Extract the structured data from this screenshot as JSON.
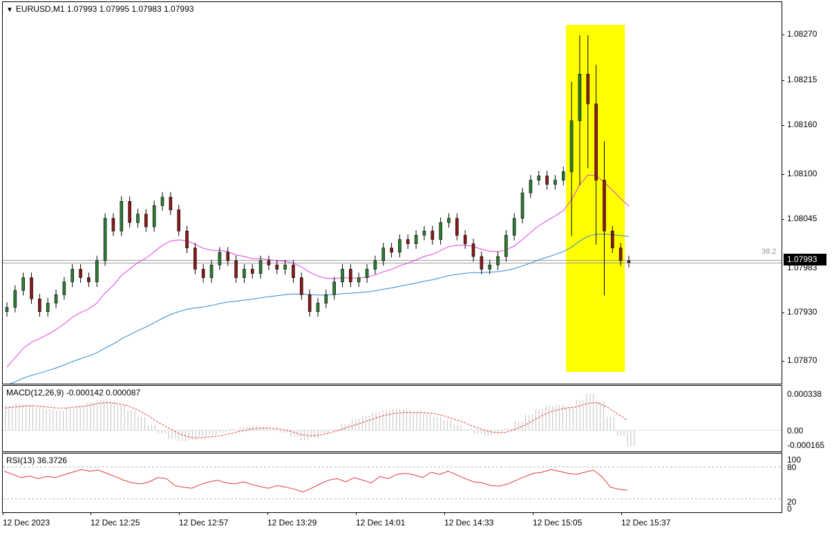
{
  "symbol_header": "EURUSD,M1  1.07993 1.07995 1.07983 1.07993",
  "current_price": "1.07993",
  "fibo_label": "38.2",
  "price_axis": [
    "1.08270",
    "1.08215",
    "1.08160",
    "1.08100",
    "1.08045",
    "1.07983",
    "1.07930",
    "1.07870"
  ],
  "macd_header": "MACD(12,26,9) -0.000142 0.000087",
  "macd_axis": [
    "0.000338",
    "0.00",
    "-0.000165"
  ],
  "rsi_header": "RSI(13) 36.3726",
  "rsi_axis": [
    "100",
    "80",
    "20",
    "0"
  ],
  "time_axis": [
    "12 Dec 2023",
    "12 Dec 12:25",
    "12 Dec 12:57",
    "12 Dec 13:29",
    "12 Dec 14:01",
    "12 Dec 14:33",
    "12 Dec 15:05",
    "12 Dec 15:37"
  ],
  "colors": {
    "bull": "#2e7d32",
    "bear": "#8b1a1a",
    "ma_fast": "#e040e0",
    "ma_slow": "#2a8ad6",
    "highlight": "#ffff00",
    "macd_hist": "#c0c0c0",
    "macd_signal": "#e53935",
    "rsi_line": "#e53935"
  },
  "chart_data": {
    "type": "candlestick",
    "symbol": "EURUSD",
    "timeframe": "M1",
    "ylim": [
      1.0785,
      1.083
    ],
    "closes": [
      1.0794,
      1.0796,
      1.07975,
      1.0795,
      1.07935,
      1.07945,
      1.07955,
      1.0797,
      1.07985,
      1.07975,
      1.0797,
      1.07995,
      1.08045,
      1.0803,
      1.08065,
      1.0804,
      1.0805,
      1.08035,
      1.0806,
      1.0807,
      1.08055,
      1.0803,
      1.0801,
      1.07985,
      1.07975,
      1.0799,
      1.08005,
      1.07995,
      1.07975,
      1.07985,
      1.0798,
      1.07995,
      1.0799,
      1.07985,
      1.0799,
      1.07975,
      1.07955,
      1.07935,
      1.07945,
      1.07955,
      1.0797,
      1.07985,
      1.0797,
      1.07975,
      1.07985,
      1.07995,
      1.0801,
      1.08005,
      1.0802,
      1.08015,
      1.08025,
      1.0803,
      1.0802,
      1.0804,
      1.08045,
      1.08025,
      1.08015,
      1.08,
      1.07985,
      1.0799,
      1.08,
      1.08025,
      1.08045,
      1.08075,
      1.0809,
      1.08095,
      1.08085,
      1.0809,
      1.081,
      1.0816,
      1.08215,
      1.0818,
      1.0809,
      1.0803,
      1.0801,
      1.07995,
      1.07993
    ],
    "ma_fast_end": 1.0805,
    "ma_slow_end": 1.08015,
    "macd_ylim": [
      -0.000165,
      0.000338
    ],
    "macd_hist": [
      0.00022,
      0.00024,
      0.00023,
      0.00021,
      0.00019,
      0.00018,
      0.0002,
      0.00022,
      0.00025,
      0.00027,
      0.00026,
      0.00023,
      0.00018,
      0.00012,
      5e-05,
      -3e-05,
      -8e-05,
      -0.0001,
      -9e-05,
      -6e-05,
      -4e-05,
      -2e-05,
      1e-05,
      3e-05,
      4e-05,
      3e-05,
      1e-05,
      -2e-05,
      -6e-05,
      -9e-05,
      -7e-05,
      -3e-05,
      1e-05,
      6e-05,
      0.0001,
      0.00013,
      0.00016,
      0.00018,
      0.00019,
      0.00018,
      0.00017,
      0.00015,
      0.00012,
      9e-05,
      5e-05,
      1e-05,
      -3e-05,
      -5e-05,
      -3e-05,
      2e-05,
      8e-05,
      0.00014,
      0.00019,
      0.00022,
      0.00023,
      0.00021,
      0.00027,
      0.00033,
      0.00026,
      0.00012,
      -5e-05,
      -0.00014
    ],
    "macd_signal": [
      0.0002,
      0.00021,
      0.00022,
      0.00022,
      0.00021,
      0.0002,
      0.0002,
      0.00021,
      0.00022,
      0.00024,
      0.00025,
      0.00024,
      0.00022,
      0.00018,
      0.00013,
      7e-05,
      2e-05,
      -3e-05,
      -6e-05,
      -7e-05,
      -6e-05,
      -5e-05,
      -3e-05,
      -1e-05,
      1e-05,
      2e-05,
      2e-05,
      1e-05,
      -1e-05,
      -4e-05,
      -5e-05,
      -4e-05,
      -2e-05,
      1e-05,
      4e-05,
      7e-05,
      0.0001,
      0.00013,
      0.00015,
      0.00016,
      0.00016,
      0.00016,
      0.00015,
      0.00013,
      0.0001,
      7e-05,
      3e-05,
      0.0,
      -2e-05,
      -2e-05,
      1e-05,
      5e-05,
      0.0001,
      0.00015,
      0.00018,
      0.0002,
      0.00021,
      0.00024,
      0.00025,
      0.00021,
      0.00015,
      9e-05
    ],
    "rsi_ylim": [
      0,
      100
    ],
    "rsi_levels": [
      80,
      20
    ],
    "rsi": [
      72,
      66,
      60,
      63,
      58,
      62,
      60,
      65,
      70,
      75,
      72,
      74,
      68,
      62,
      55,
      50,
      48,
      52,
      60,
      58,
      45,
      42,
      40,
      47,
      52,
      55,
      50,
      48,
      52,
      47,
      43,
      40,
      45,
      42,
      38,
      33,
      40,
      48,
      55,
      58,
      52,
      60,
      55,
      50,
      62,
      58,
      66,
      68,
      65,
      60,
      70,
      66,
      72,
      65,
      58,
      52,
      50,
      45,
      44,
      48,
      55,
      62,
      68,
      70,
      75,
      72,
      68,
      66,
      70,
      74,
      62,
      42,
      38,
      36
    ]
  }
}
